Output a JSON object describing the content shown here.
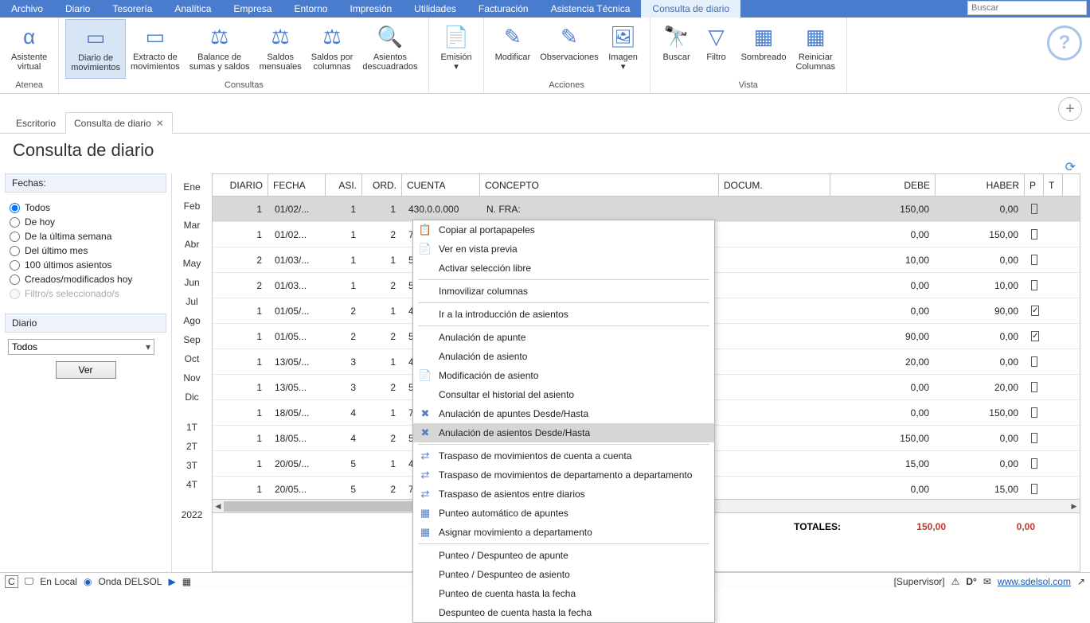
{
  "search_placeholder": "Buscar",
  "menu": [
    "Archivo",
    "Diario",
    "Tesorería",
    "Analítica",
    "Empresa",
    "Entorno",
    "Impresión",
    "Utilidades",
    "Facturación",
    "Asistencia Técnica",
    "Consulta de diario"
  ],
  "menu_active_index": 10,
  "ribbon": {
    "groups": [
      {
        "label": "Atenea",
        "items": [
          {
            "icon": "α",
            "t1": "Asistente",
            "t2": "virtual"
          }
        ]
      },
      {
        "label": "Consultas",
        "items": [
          {
            "icon": "▭",
            "t1": "Diario de",
            "t2": "movimientos",
            "active": true
          },
          {
            "icon": "▭",
            "t1": "Extracto de",
            "t2": "movimientos"
          },
          {
            "icon": "⚖",
            "t1": "Balance de",
            "t2": "sumas y saldos"
          },
          {
            "icon": "⚖",
            "t1": "Saldos",
            "t2": "mensuales"
          },
          {
            "icon": "⚖",
            "t1": "Saldos por",
            "t2": "columnas"
          },
          {
            "icon": "🔍",
            "t1": "Asientos",
            "t2": "descuadrados"
          }
        ]
      },
      {
        "label": "",
        "items": [
          {
            "icon": "📄",
            "t1": "Emisión",
            "t2": "▾"
          }
        ]
      },
      {
        "label": "Acciones",
        "items": [
          {
            "icon": "✎",
            "t1": "Modificar",
            "t2": ""
          },
          {
            "icon": "✎",
            "t1": "Observaciones",
            "t2": ""
          },
          {
            "icon": "🖼",
            "t1": "Imagen",
            "t2": "▾"
          }
        ]
      },
      {
        "label": "Vista",
        "items": [
          {
            "icon": "🔭",
            "t1": "Buscar",
            "t2": ""
          },
          {
            "icon": "▽",
            "t1": "Filtro",
            "t2": ""
          },
          {
            "icon": "▦",
            "t1": "Sombreado",
            "t2": ""
          },
          {
            "icon": "▦",
            "t1": "Reiniciar",
            "t2": "Columnas"
          }
        ]
      }
    ]
  },
  "tabs": {
    "t0": "Escritorio",
    "t1": "Consulta de diario"
  },
  "page_title": "Consulta de diario",
  "filters": {
    "fechas_label": "Fechas:",
    "options": [
      "Todos",
      "De hoy",
      "De la última semana",
      "Del último mes",
      "100 últimos asientos",
      "Creados/modificados hoy",
      "Filtro/s seleccionado/s"
    ],
    "disabled_index": 6,
    "diario_label": "Diario",
    "diario_value": "Todos",
    "ver": "Ver"
  },
  "months": [
    "Ene",
    "Feb",
    "Mar",
    "Abr",
    "May",
    "Jun",
    "Jul",
    "Ago",
    "Sep",
    "Oct",
    "Nov",
    "Dic",
    "",
    "1T",
    "2T",
    "3T",
    "4T",
    "",
    "2022"
  ],
  "grid": {
    "headers": {
      "diario": "DIARIO",
      "fecha": "FECHA",
      "asi": "ASI.",
      "ord": "ORD.",
      "cuenta": "CUENTA",
      "concepto": "CONCEPTO",
      "docum": "DOCUM.",
      "debe": "DEBE",
      "haber": "HABER",
      "p": "P",
      "t": "T"
    },
    "rows": [
      {
        "d": "1",
        "f": "01/02/...",
        "a": "1",
        "o": "1",
        "cu": "430.0.0.000",
        "co": "N. FRA:",
        "debe": "150,00",
        "haber": "0,00",
        "p": false,
        "sel": true
      },
      {
        "d": "1",
        "f": "01/02...",
        "a": "1",
        "o": "2",
        "cu": "700",
        "co": "",
        "debe": "0,00",
        "haber": "150,00",
        "p": false
      },
      {
        "d": "2",
        "f": "01/03/...",
        "a": "1",
        "o": "1",
        "cu": "570",
        "co": "",
        "debe": "10,00",
        "haber": "0,00",
        "p": false
      },
      {
        "d": "2",
        "f": "01/03...",
        "a": "1",
        "o": "2",
        "cu": "572",
        "co": "",
        "debe": "0,00",
        "haber": "10,00",
        "p": false
      },
      {
        "d": "1",
        "f": "01/05/...",
        "a": "2",
        "o": "1",
        "cu": "430",
        "co": "",
        "debe": "0,00",
        "haber": "90,00",
        "p": true
      },
      {
        "d": "1",
        "f": "01/05...",
        "a": "2",
        "o": "2",
        "cu": "572",
        "co": "",
        "debe": "90,00",
        "haber": "0,00",
        "p": true
      },
      {
        "d": "1",
        "f": "13/05/...",
        "a": "3",
        "o": "1",
        "cu": "400",
        "co": "",
        "debe": "20,00",
        "haber": "0,00",
        "p": false
      },
      {
        "d": "1",
        "f": "13/05...",
        "a": "3",
        "o": "2",
        "cu": "570",
        "co": "",
        "debe": "0,00",
        "haber": "20,00",
        "p": false
      },
      {
        "d": "1",
        "f": "18/05/...",
        "a": "4",
        "o": "1",
        "cu": "762",
        "co": "",
        "debe": "0,00",
        "haber": "150,00",
        "p": false
      },
      {
        "d": "1",
        "f": "18/05...",
        "a": "4",
        "o": "2",
        "cu": "572",
        "co": "",
        "debe": "150,00",
        "haber": "0,00",
        "p": false
      },
      {
        "d": "1",
        "f": "20/05/...",
        "a": "5",
        "o": "1",
        "cu": "430",
        "co": "",
        "debe": "15,00",
        "haber": "0,00",
        "p": false
      },
      {
        "d": "1",
        "f": "20/05...",
        "a": "5",
        "o": "2",
        "cu": "700",
        "co": "",
        "debe": "0,00",
        "haber": "15,00",
        "p": false
      }
    ],
    "totals": {
      "label": "TOTALES:",
      "debe": "150,00",
      "haber": "0,00"
    }
  },
  "context_menu": [
    {
      "icon": "📋",
      "label": "Copiar al portapapeles"
    },
    {
      "icon": "📄",
      "label": "Ver en vista previa"
    },
    {
      "icon": "",
      "label": "Activar selección libre"
    },
    {
      "sep": true
    },
    {
      "icon": "",
      "label": "Inmovilizar columnas"
    },
    {
      "sep": true
    },
    {
      "icon": "",
      "label": "Ir a la introducción de asientos"
    },
    {
      "sep": true
    },
    {
      "icon": "",
      "label": "Anulación de apunte"
    },
    {
      "icon": "",
      "label": "Anulación de asiento"
    },
    {
      "icon": "📄",
      "label": "Modificación de asiento"
    },
    {
      "icon": "",
      "label": "Consultar el historial del asiento"
    },
    {
      "icon": "✖",
      "label": "Anulación de apuntes Desde/Hasta"
    },
    {
      "icon": "✖",
      "label": "Anulación de asientos Desde/Hasta",
      "hl": true
    },
    {
      "sep": true
    },
    {
      "icon": "⇄",
      "label": "Traspaso de movimientos de cuenta a cuenta"
    },
    {
      "icon": "⇄",
      "label": "Traspaso de movimientos de departamento a departamento"
    },
    {
      "icon": "⇄",
      "label": "Traspaso de asientos entre diarios"
    },
    {
      "icon": "▦",
      "label": "Punteo automático de apuntes"
    },
    {
      "icon": "▦",
      "label": "Asignar movimiento a departamento"
    },
    {
      "sep": true
    },
    {
      "icon": "",
      "label": "Punteo / Despunteo de apunte"
    },
    {
      "icon": "",
      "label": "Punteo / Despunteo de asiento"
    },
    {
      "icon": "",
      "label": "Punteo de cuenta hasta la fecha"
    },
    {
      "icon": "",
      "label": "Despunteo de cuenta hasta la fecha"
    }
  ],
  "status": {
    "c": "C",
    "local": "En Local",
    "onda": "Onda DELSOL",
    "supervisor": "[Supervisor]",
    "url": "www.sdelsol.com"
  }
}
